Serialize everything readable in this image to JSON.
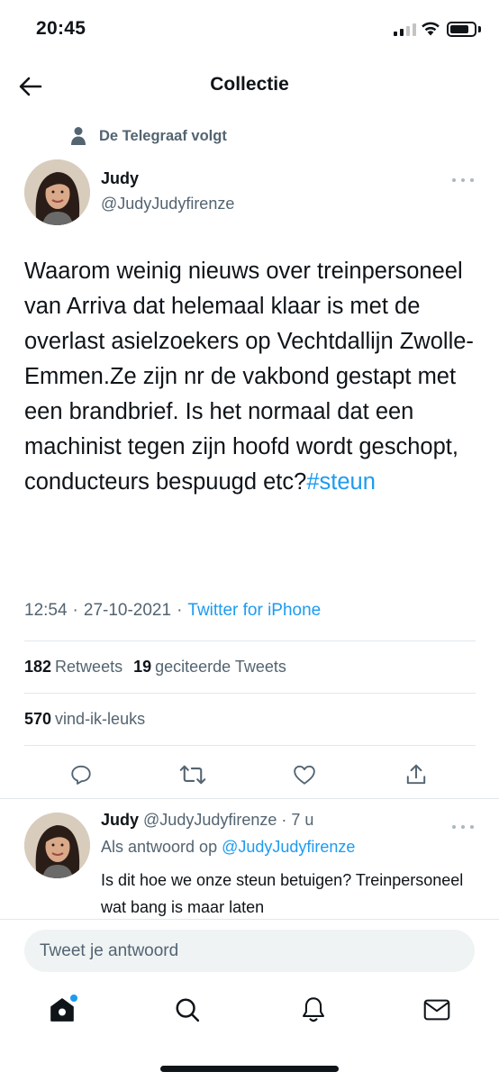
{
  "status_bar": {
    "time": "20:45",
    "icons": [
      "cellular-signal-icon",
      "wifi-icon",
      "battery-icon"
    ]
  },
  "header": {
    "title": "Collectie",
    "back_icon": "arrow-left-icon"
  },
  "social_context": {
    "icon": "person-icon",
    "text": "De Telegraaf volgt"
  },
  "tweet": {
    "author_name": "Judy",
    "author_handle": "@JudyJudyfirenze",
    "body": "Waarom weinig nieuws over treinpersoneel van Arriva dat helemaal klaar is met de overlast asielzoekers op Vechtdallijn Zwolle-Emmen.Ze zijn nr de vakbond gestapt met een brandbrief. Is het normaal dat een machinist tegen zijn hoofd wordt geschopt, conducteurs bespuugd etc?",
    "hashtag": "#steun",
    "time": "12:54",
    "date": "27-10-2021",
    "separator": "·",
    "source": "Twitter for iPhone",
    "retweets_count": "182",
    "retweets_label": "Retweets",
    "quotes_count": "19",
    "quotes_label": "geciteerde Tweets",
    "likes_count": "570",
    "likes_label": "vind-ik-leuks"
  },
  "actions": [
    "reply-icon",
    "retweet-icon",
    "like-icon",
    "share-icon"
  ],
  "reply": {
    "author_name": "Judy",
    "author_handle": "@JudyJudyfirenze",
    "age": "· 7 u",
    "reply_prefix": "Als antwoord op",
    "reply_to": "@JudyJudyfirenze",
    "body": "Is dit hoe we onze steun betuigen? Treinpersoneel wat bang is maar laten"
  },
  "compose": {
    "placeholder": "Tweet je antwoord"
  },
  "tab_bar": [
    "home-icon",
    "search-icon",
    "notifications-icon",
    "messages-icon"
  ],
  "colors": {
    "accent": "#1d9bf0",
    "text": "#0f1419",
    "secondary": "#536471",
    "divider": "#e1e8ed"
  }
}
